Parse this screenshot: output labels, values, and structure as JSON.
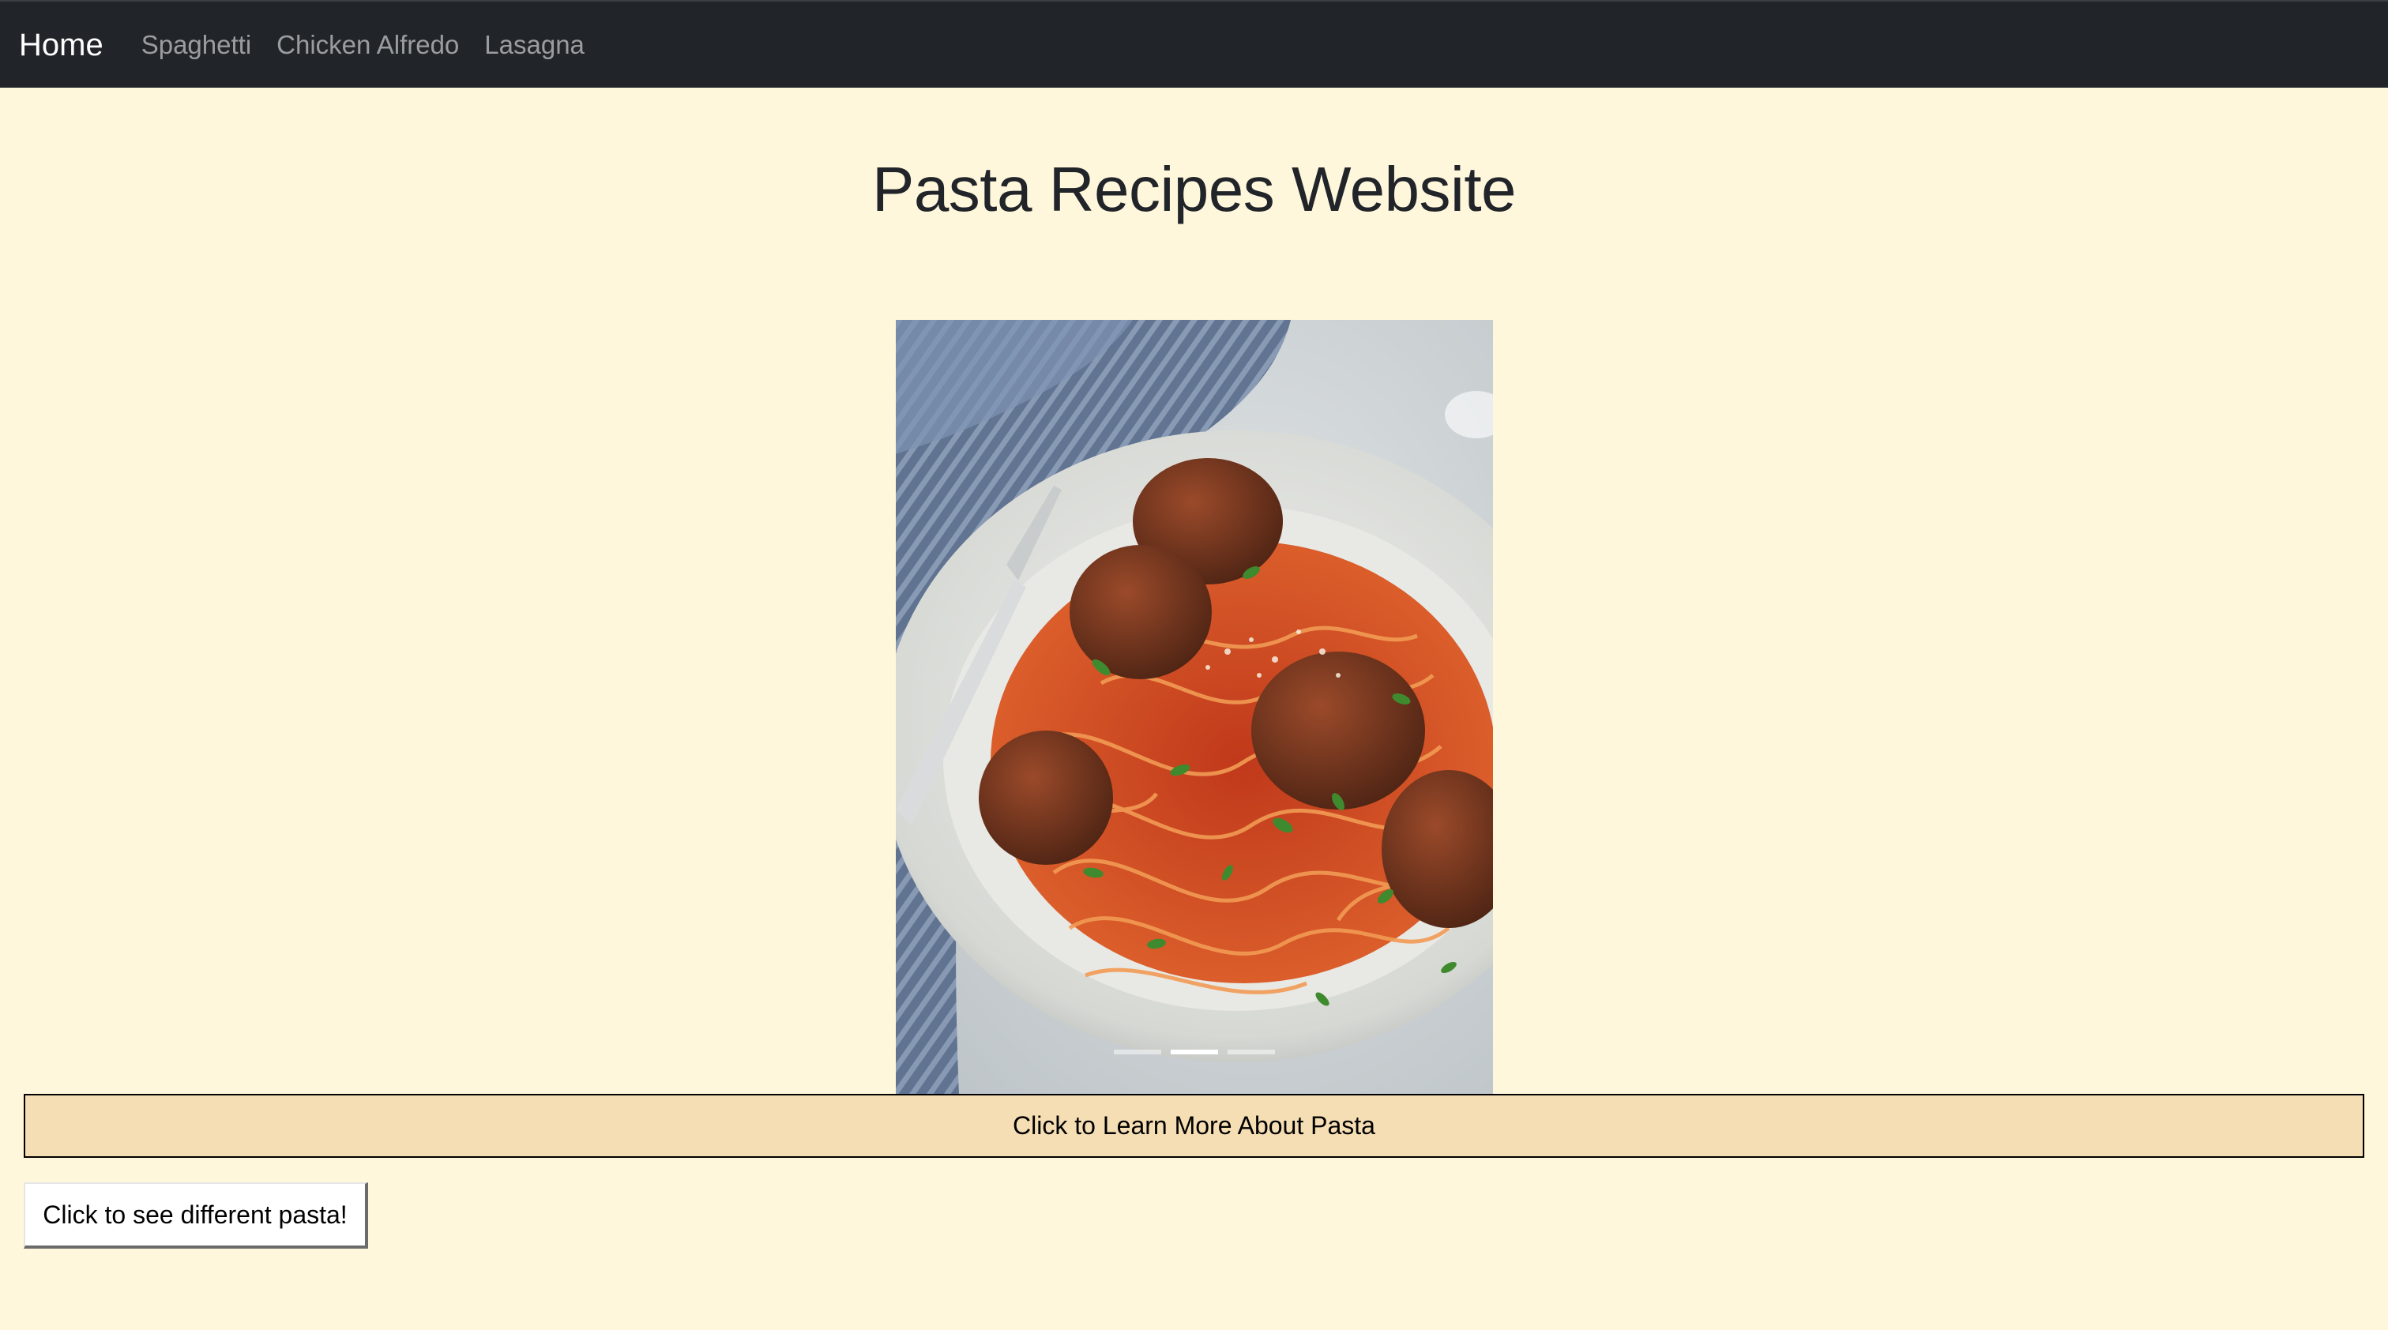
{
  "navbar": {
    "brand": "Home",
    "links": [
      "Spaghetti",
      "Chicken Alfredo",
      "Lasagna"
    ]
  },
  "main": {
    "title": "Pasta Recipes Website",
    "carousel": {
      "image": "spaghetti-and-meatballs-photo",
      "slide_count": 3,
      "active_index": 1
    },
    "learn_button": "Click to Learn More About Pasta",
    "switch_button": "Click to see different pasta!"
  },
  "colors": {
    "page_background": "#fff7dc",
    "navbar_background": "#212529",
    "learn_button_background": "#f5deb3"
  }
}
